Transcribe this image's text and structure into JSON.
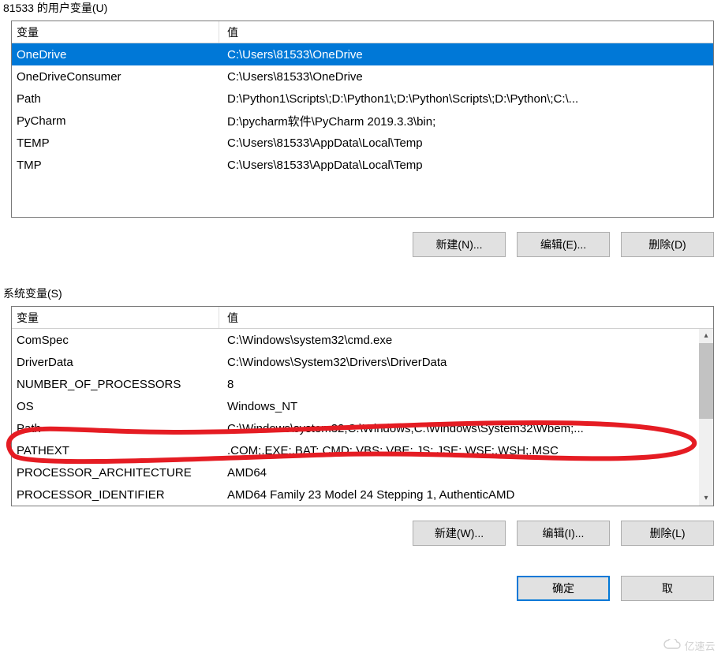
{
  "user_section": {
    "label": "81533 的用户变量(U)",
    "headers": {
      "var": "变量",
      "val": "值"
    },
    "rows": [
      {
        "var": "OneDrive",
        "val": "C:\\Users\\81533\\OneDrive",
        "selected": true
      },
      {
        "var": "OneDriveConsumer",
        "val": "C:\\Users\\81533\\OneDrive"
      },
      {
        "var": "Path",
        "val": "D:\\Python1\\Scripts\\;D:\\Python1\\;D:\\Python\\Scripts\\;D:\\Python\\;C:\\..."
      },
      {
        "var": "PyCharm",
        "val": "D:\\pycharm软件\\PyCharm 2019.3.3\\bin;"
      },
      {
        "var": "TEMP",
        "val": "C:\\Users\\81533\\AppData\\Local\\Temp"
      },
      {
        "var": "TMP",
        "val": "C:\\Users\\81533\\AppData\\Local\\Temp"
      }
    ],
    "buttons": {
      "new": "新建(N)...",
      "edit": "编辑(E)...",
      "del": "删除(D)"
    }
  },
  "sys_section": {
    "label": "系统变量(S)",
    "headers": {
      "var": "变量",
      "val": "值"
    },
    "rows": [
      {
        "var": "ComSpec",
        "val": "C:\\Windows\\system32\\cmd.exe"
      },
      {
        "var": "DriverData",
        "val": "C:\\Windows\\System32\\Drivers\\DriverData"
      },
      {
        "var": "NUMBER_OF_PROCESSORS",
        "val": "8"
      },
      {
        "var": "OS",
        "val": "Windows_NT"
      },
      {
        "var": "Path",
        "val": "C:\\Windows\\system32;C:\\Windows;C:\\Windows\\System32\\Wbem;..."
      },
      {
        "var": "PATHEXT",
        "val": ".COM;.EXE;.BAT;.CMD;.VBS;.VBE;.JS;.JSE;.WSF;.WSH;.MSC"
      },
      {
        "var": "PROCESSOR_ARCHITECTURE",
        "val": "AMD64"
      },
      {
        "var": "PROCESSOR_IDENTIFIER",
        "val": "AMD64 Family 23 Model 24 Stepping 1, AuthenticAMD"
      }
    ],
    "buttons": {
      "new": "新建(W)...",
      "edit": "编辑(I)...",
      "del": "删除(L)"
    }
  },
  "dialog_buttons": {
    "ok": "确定",
    "cancel": "取"
  },
  "annotation": {
    "color": "#e51c23",
    "target_row_var": "Path",
    "target_row_val": "C:\\Windows\\system32;C:\\Windows;C:\\Windows\\System32\\Wbem;..."
  },
  "watermark": {
    "text": "亿速云"
  }
}
